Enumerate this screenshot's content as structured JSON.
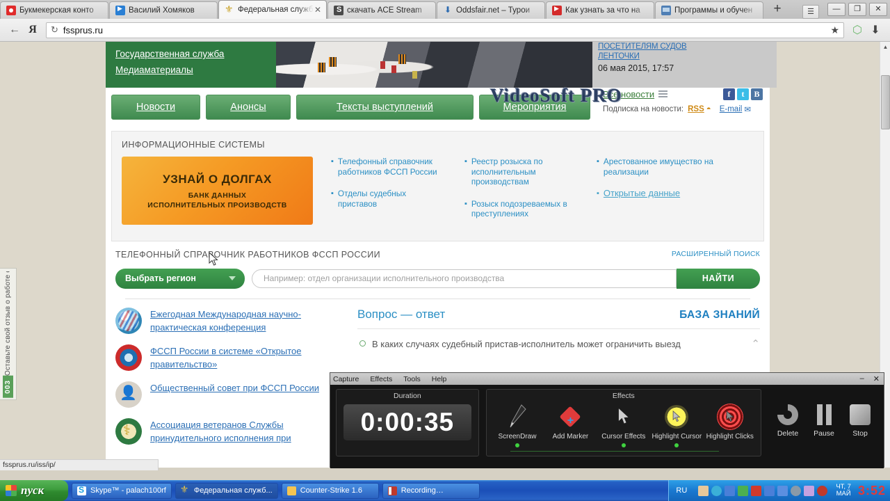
{
  "browser": {
    "tabs": [
      {
        "title": "Букмекерская конто",
        "icon": "bookmaker-icon",
        "active": false
      },
      {
        "title": "Василий Хомяков",
        "icon": "video-play-icon",
        "active": false
      },
      {
        "title": "Федеральная служб",
        "icon": "fssp-emblem-icon",
        "active": true
      },
      {
        "title": "скачать ACE Stream",
        "icon": "ace-stream-icon",
        "active": false
      },
      {
        "title": "Oddsfair.net – Турои",
        "icon": "download-arrow-icon",
        "active": false
      },
      {
        "title": "Как узнать за что на",
        "icon": "youtube-icon",
        "active": false
      },
      {
        "title": "Программы и обучен",
        "icon": "monitor-icon",
        "active": false
      }
    ],
    "new_tab_label": "+",
    "menu_label": "☰",
    "window_controls": {
      "minimize": "—",
      "restore": "❐",
      "close": "✕"
    },
    "back_label": "←",
    "yandex_label": "Я",
    "reload_label": "↻",
    "url": "fssprus.ru",
    "star_label": "★",
    "shield_label": "⬡",
    "download_label": "⬇",
    "status_url": "fssprus.ru/iss/ip/"
  },
  "feedback": {
    "badge": "003",
    "text": "Оставьте свой отзыв о работе сайта"
  },
  "hero": {
    "green_links": [
      "Государственная служба",
      "Медиаматериалы"
    ],
    "news_headline_1": "ПОСЕТИТЕЛЯМ СУДОВ",
    "news_headline_2": "ЛЕНТОЧКИ",
    "news_date": "06 мая 2015, 17:57",
    "watermark": "VideoSoft PRO"
  },
  "nav": {
    "buttons": [
      "Новости",
      "Анонсы",
      "Тексты выступлений",
      "Мероприятия"
    ],
    "all_news": "Все новости",
    "subscribe_label": "Подписка на новости:",
    "rss": "RSS",
    "email": "E-mail",
    "social": [
      "f",
      "t",
      "B"
    ]
  },
  "infosys": {
    "title": "ИНФОРМАЦИОННЫЕ СИСТЕМЫ",
    "banner": {
      "line1": "УЗНАЙ О ДОЛГАХ",
      "line2": "БАНК ДАННЫХ",
      "line3": "ИСПОЛНИТЕЛЬНЫХ ПРОИЗВОДСТВ"
    },
    "col1": [
      "Телефонный справочник работников ФССП России",
      "Отделы судебных приставов"
    ],
    "col2": [
      "Реестр розыска по исполнительным производствам",
      "Розыск подозреваемых в преступлениях"
    ],
    "col3": [
      "Арестованное имущество на реализации",
      "Открытые данные"
    ]
  },
  "phonedir": {
    "title": "ТЕЛЕФОННЫЙ СПРАВОЧНИК РАБОТНИКОВ ФССП РОССИИ",
    "advanced": "РАСШИРЕННЫЙ ПОИСК",
    "region_label": "Выбрать регион",
    "input_value": "",
    "input_placeholder": "Например: отдел организации исполнительного производства",
    "search_button": "НАЙТИ"
  },
  "promos": [
    {
      "icon": "globe-flags-icon",
      "label": "Ежегодная Международная научно-практическая конференция"
    },
    {
      "icon": "open-government-icon",
      "label": "ФССП России в системе «Открытое правительство»"
    },
    {
      "icon": "people-icon",
      "label": "Общественный совет при ФССП России"
    },
    {
      "icon": "association-emblem-icon",
      "label": "Ассоциация ветеранов Службы принудительного исполнения при"
    }
  ],
  "qa": {
    "title": "Вопрос — ответ",
    "kb_title": "БАЗА ЗНАНИЙ",
    "question": "В каких случаях судебный пристав-исполнитель может ограничить выезд",
    "chevron": "⌃"
  },
  "recorder": {
    "menu": [
      "Capture",
      "Effects",
      "Tools",
      "Help"
    ],
    "minimize": "–",
    "close": "✕",
    "duration_title": "Duration",
    "duration_value": "0:00:35",
    "effects_title": "Effects",
    "effects": [
      {
        "label": "ScreenDraw",
        "icon": "pen-icon"
      },
      {
        "label": "Add Marker",
        "icon": "marker-diamond-icon"
      },
      {
        "label": "Cursor Effects",
        "icon": "cursor-arrow-icon"
      },
      {
        "label": "Highlight Cursor",
        "icon": "highlight-cursor-icon"
      },
      {
        "label": "Highlight Clicks",
        "icon": "highlight-clicks-icon"
      }
    ],
    "controls": [
      {
        "label": "Delete",
        "icon": "delete-icon"
      },
      {
        "label": "Pause",
        "icon": "pause-icon"
      },
      {
        "label": "Stop",
        "icon": "stop-icon"
      }
    ]
  },
  "taskbar": {
    "start_label": "пуск",
    "buttons": [
      {
        "label": "Skype™ - palach100rf",
        "icon": "skype-icon",
        "active": false
      },
      {
        "label": "Федеральная служб...",
        "icon": "fssp-emblem-icon",
        "active": true
      },
      {
        "label": "Counter-Strike 1.6",
        "icon": "folder-icon",
        "active": false
      },
      {
        "label": "Recording…",
        "icon": "recording-icon",
        "active": false
      }
    ],
    "language": "RU",
    "date_line1": "ЧТ, 7",
    "date_line2": "МАЙ",
    "time": "3:52"
  },
  "colors": {
    "green": "#2e7a41",
    "orange": "#f59a24",
    "link_blue": "#2b8fc4",
    "taskbar_blue": "#1b4fb8"
  }
}
